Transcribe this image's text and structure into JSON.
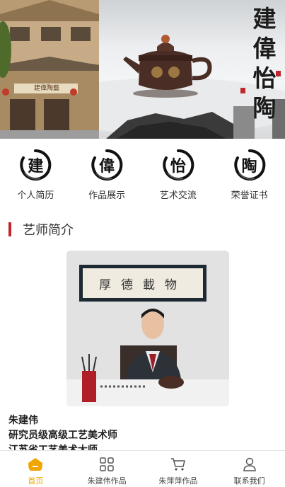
{
  "banner": {
    "title_chars": [
      "建",
      "偉",
      "怡",
      "陶"
    ],
    "sign_text": "建偉陶藝"
  },
  "nav": [
    {
      "label": "个人简历",
      "glyph": "建"
    },
    {
      "label": "作品展示",
      "glyph": "偉"
    },
    {
      "label": "艺术交流",
      "glyph": "怡"
    },
    {
      "label": "荣誉证书",
      "glyph": "陶"
    }
  ],
  "section": {
    "title": "艺师简介",
    "accent_color": "#c0272d"
  },
  "profile": {
    "calligraphy": "厚德載物",
    "lines": [
      "朱建伟",
      "研究员级高级工艺美术师",
      "江苏省工艺美术大师"
    ]
  },
  "tabbar": {
    "active_color": "#f0a500",
    "items": [
      {
        "label": "首页",
        "icon": "home-icon",
        "active": true
      },
      {
        "label": "朱建伟作品",
        "icon": "grid-icon",
        "active": false
      },
      {
        "label": "朱萍萍作品",
        "icon": "cart-icon",
        "active": false
      },
      {
        "label": "联系我们",
        "icon": "user-icon",
        "active": false
      }
    ]
  }
}
